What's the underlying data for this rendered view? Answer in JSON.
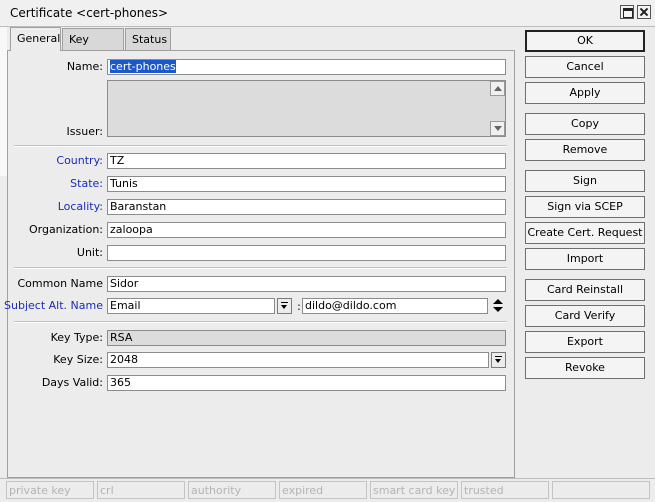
{
  "window": {
    "title": "Certificate <cert-phones>"
  },
  "tabs": [
    {
      "label": "General",
      "active": true
    },
    {
      "label": "Key Usage",
      "active": false
    },
    {
      "label": "Status",
      "active": false
    }
  ],
  "form": {
    "name": {
      "label": "Name:",
      "value": "cert-phones"
    },
    "issuer": {
      "label": "Issuer:",
      "value": ""
    },
    "country": {
      "label": "Country:",
      "value": "TZ"
    },
    "state": {
      "label": "State:",
      "value": "Tunis"
    },
    "locality": {
      "label": "Locality:",
      "value": "Baranstan"
    },
    "organization": {
      "label": "Organization:",
      "value": "zaloopa"
    },
    "unit": {
      "label": "Unit:",
      "value": ""
    },
    "common_name": {
      "label": "Common Name",
      "value": "Sidor"
    },
    "subject_alt_name": {
      "label": "Subject Alt. Name",
      "type": "Email",
      "separator": ":",
      "value": "dildo@dildo.com"
    },
    "key_type": {
      "label": "Key Type:",
      "value": "RSA"
    },
    "key_size": {
      "label": "Key Size:",
      "value": "2048"
    },
    "days_valid": {
      "label": "Days Valid:",
      "value": "365"
    }
  },
  "buttons": {
    "ok": "OK",
    "cancel": "Cancel",
    "apply": "Apply",
    "copy": "Copy",
    "remove": "Remove",
    "sign": "Sign",
    "sign_scep": "Sign via SCEP",
    "create_request": "Create Cert. Request",
    "import": "Import",
    "card_reinstall": "Card Reinstall",
    "card_verify": "Card Verify",
    "export": "Export",
    "revoke": "Revoke"
  },
  "status_bar": [
    "private key",
    "crl",
    "authority",
    "expired",
    "smart card key",
    "trusted",
    ""
  ],
  "colors": {
    "link_label": "#1b2bb8",
    "selection": "#1c58c9",
    "readonly_field": "#dcdcdc"
  },
  "icons": [
    "maximize-icon",
    "close-icon",
    "scroll-up-icon",
    "scroll-down-icon",
    "dropdown-icon",
    "updown-icon"
  ]
}
